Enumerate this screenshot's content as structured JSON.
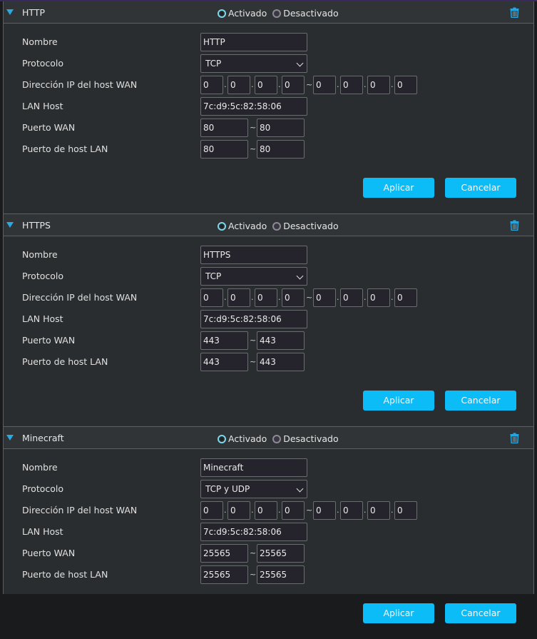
{
  "labels": {
    "enabled": "Activado",
    "disabled": "Desactivado",
    "name": "Nombre",
    "protocol": "Protocolo",
    "wan_ip": "Dirección IP del host WAN",
    "lan_host": "LAN Host",
    "wan_port": "Puerto WAN",
    "lan_port": "Puerto de host LAN",
    "apply": "Aplicar",
    "cancel": "Cancelar",
    "ip_sep": ".",
    "range_sep": "~"
  },
  "icons": {
    "collapse": "triangle-down-icon",
    "delete": "trash-icon"
  },
  "colors": {
    "accent": "#0bbcf6",
    "arrow": "#29a9e1",
    "radio_on": "#7ad8ea"
  },
  "rules": [
    {
      "title": "HTTP",
      "status": "enabled",
      "name": "HTTP",
      "protocol": "TCP",
      "wan_ip_start": [
        "0",
        "0",
        "0",
        "0"
      ],
      "wan_ip_end": [
        "0",
        "0",
        "0",
        "0"
      ],
      "lan_host": "7c:d9:5c:82:58:06",
      "wan_port_start": "80",
      "wan_port_end": "80",
      "lan_port_start": "80",
      "lan_port_end": "80"
    },
    {
      "title": "HTTPS",
      "status": "enabled",
      "name": "HTTPS",
      "protocol": "TCP",
      "wan_ip_start": [
        "0",
        "0",
        "0",
        "0"
      ],
      "wan_ip_end": [
        "0",
        "0",
        "0",
        "0"
      ],
      "lan_host": "7c:d9:5c:82:58:06",
      "wan_port_start": "443",
      "wan_port_end": "443",
      "lan_port_start": "443",
      "lan_port_end": "443"
    },
    {
      "title": "Minecraft",
      "status": "enabled",
      "name": "Minecraft",
      "protocol": "TCP y UDP",
      "wan_ip_start": [
        "0",
        "0",
        "0",
        "0"
      ],
      "wan_ip_end": [
        "0",
        "0",
        "0",
        "0"
      ],
      "lan_host": "7c:d9:5c:82:58:06",
      "wan_port_start": "25565",
      "wan_port_end": "25565",
      "lan_port_start": "25565",
      "lan_port_end": "25565"
    }
  ]
}
